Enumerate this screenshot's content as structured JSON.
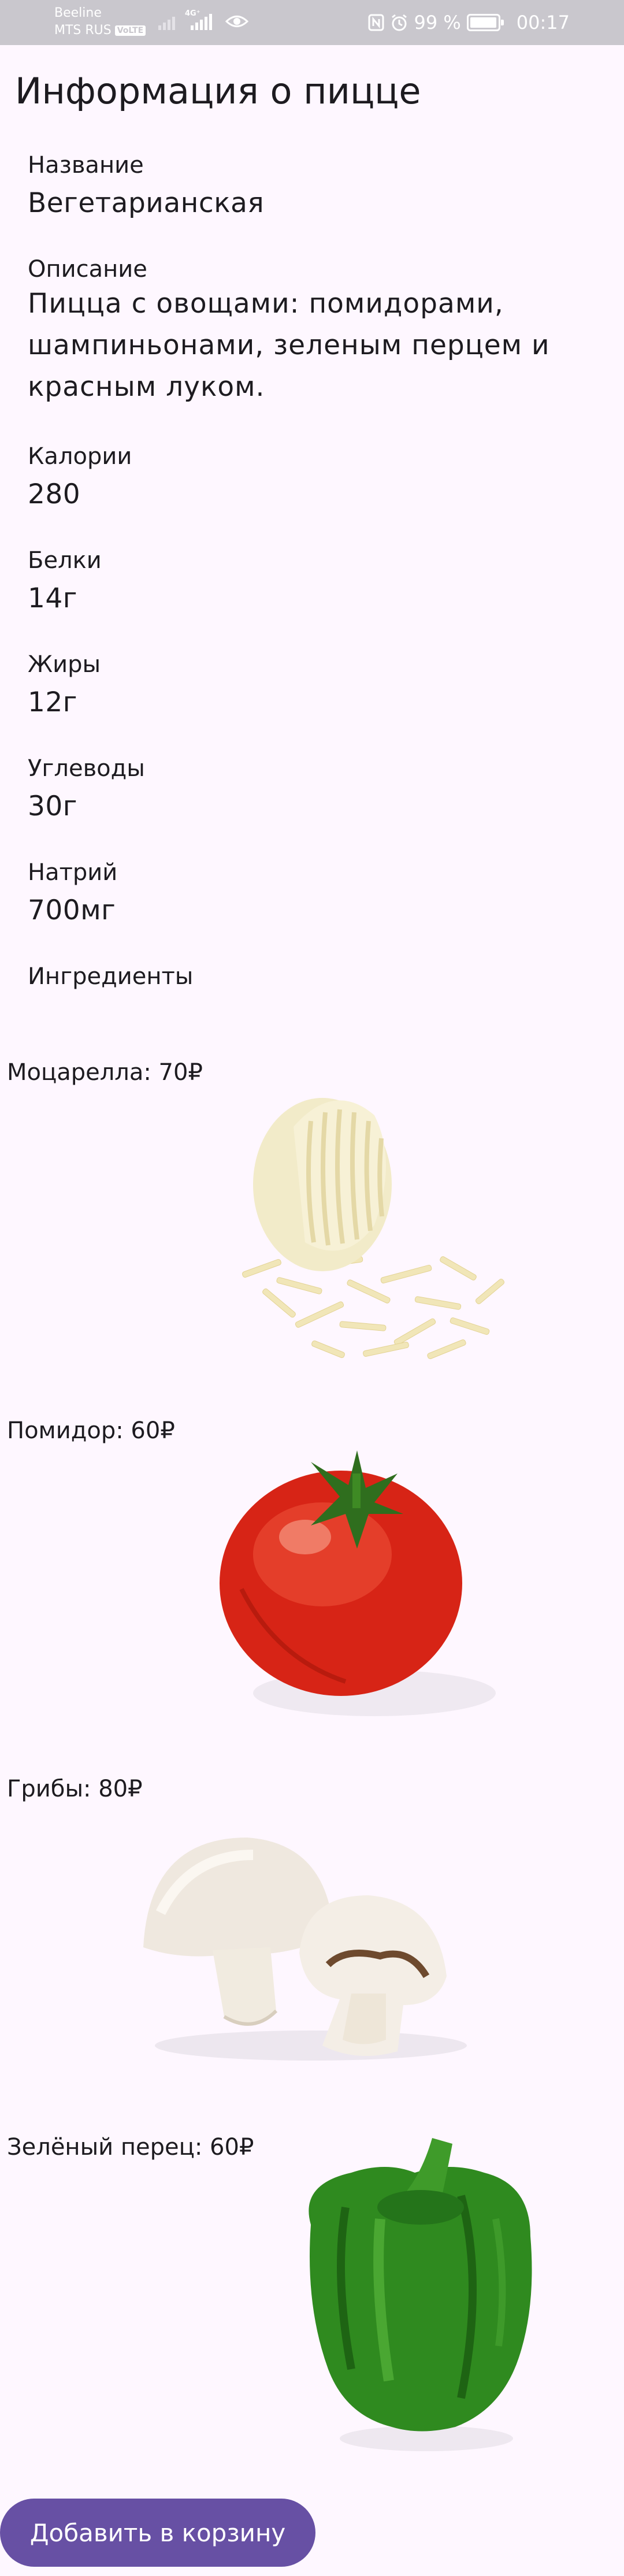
{
  "status_bar": {
    "carrier_1": "Beeline",
    "carrier_2": "MTS RUS",
    "volte_badge": "VoLTE",
    "network_type": "4G⁺",
    "battery_percent": "99 %",
    "battery_level": 0.99,
    "time": "00:17",
    "icons": [
      "signal-icon",
      "eye-icon",
      "nfc-icon",
      "alarm-icon",
      "battery-icon"
    ]
  },
  "page": {
    "title": "Информация о пицце"
  },
  "pizza": {
    "name_label": "Название",
    "name_value": "Вегетарианская",
    "description_label": "Описание",
    "description_value": "Пицца с овощами: помидорами, шампиньонами, зеленым перцем и красным луком.",
    "calories_label": "Калории",
    "calories_value": "280",
    "protein_label": "Белки",
    "protein_value": "14г",
    "fat_label": "Жиры",
    "fat_value": "12г",
    "carbs_label": "Углеводы",
    "carbs_value": "30г",
    "sodium_label": "Натрий",
    "sodium_value": "700мг",
    "ingredients_label": "Ингредиенты"
  },
  "ingredients": [
    {
      "label": "Моцарелла: 70₽",
      "image": "mozzarella-image"
    },
    {
      "label": "Помидор: 60₽",
      "image": "tomato-image"
    },
    {
      "label": "Грибы: 80₽",
      "image": "mushrooms-image"
    },
    {
      "label": "Зелёный перец: 60₽",
      "image": "green-pepper-image"
    }
  ],
  "actions": {
    "add_to_cart": "Добавить в корзину"
  },
  "colors": {
    "background": "#FEF7FF",
    "status_bar": "#C9C7CD",
    "primary": "#6750A4",
    "text": "#1D1B20"
  }
}
